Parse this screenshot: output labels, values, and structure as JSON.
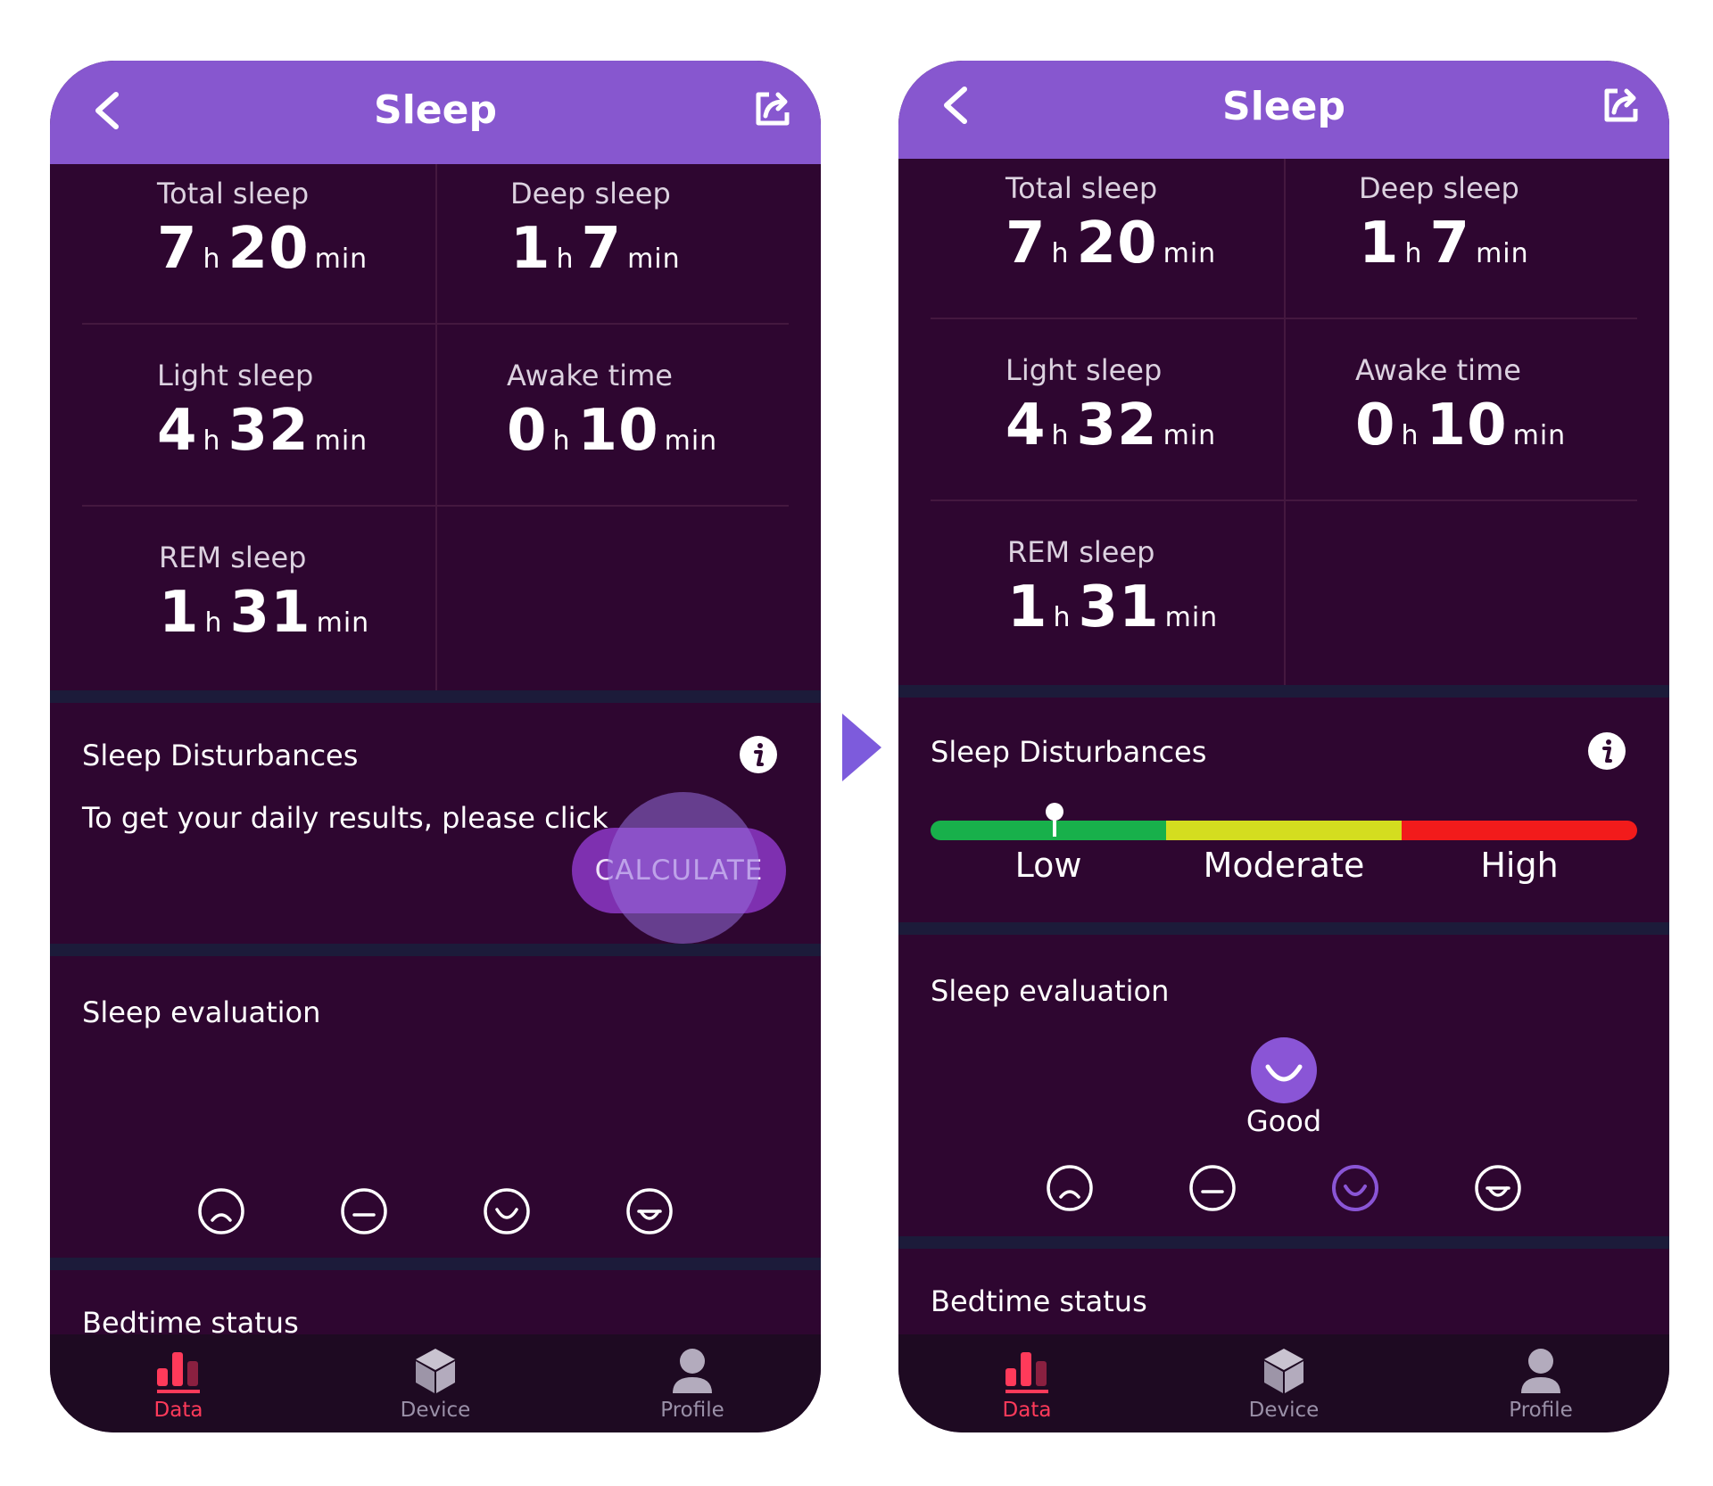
{
  "colors": {
    "header": "#8757cf",
    "background": "#2e0630",
    "accent_active": "#ff3a5a",
    "low": "#18b04b",
    "moderate": "#d4dd1f",
    "high": "#f21b1b",
    "good_face": "#8a55d6"
  },
  "before": {
    "header": {
      "title": "Sleep",
      "back_icon": "chevron-left-icon",
      "share_icon": "share-icon"
    },
    "stats": [
      {
        "label": "Total sleep",
        "hours": "7",
        "minutes": "20"
      },
      {
        "label": "Deep sleep",
        "hours": "1",
        "minutes": "7"
      },
      {
        "label": "Light sleep",
        "hours": "4",
        "minutes": "32"
      },
      {
        "label": "Awake time",
        "hours": "0",
        "minutes": "10"
      },
      {
        "label": "REM sleep",
        "hours": "1",
        "minutes": "31"
      }
    ],
    "units": {
      "hour": "h",
      "minute": "min"
    },
    "disturbances": {
      "title": "Sleep Disturbances",
      "message": "To get your daily results, please click",
      "button_label": "CALCULATE"
    },
    "evaluation": {
      "title": "Sleep evaluation",
      "faces": [
        "sad-face-icon",
        "neutral-face-icon",
        "smile-face-icon",
        "grin-face-icon"
      ]
    },
    "bedtime": {
      "title": "Bedtime status"
    },
    "tabs": [
      {
        "label": "Data",
        "icon": "bar-chart-icon",
        "active": true
      },
      {
        "label": "Device",
        "icon": "cube-icon",
        "active": false
      },
      {
        "label": "Profile",
        "icon": "person-icon",
        "active": false
      }
    ]
  },
  "after": {
    "header": {
      "title": "Sleep",
      "back_icon": "chevron-left-icon",
      "share_icon": "share-icon"
    },
    "stats": [
      {
        "label": "Total sleep",
        "hours": "7",
        "minutes": "20"
      },
      {
        "label": "Deep sleep",
        "hours": "1",
        "minutes": "7"
      },
      {
        "label": "Light sleep",
        "hours": "4",
        "minutes": "32"
      },
      {
        "label": "Awake time",
        "hours": "0",
        "minutes": "10"
      },
      {
        "label": "REM sleep",
        "hours": "1",
        "minutes": "31"
      }
    ],
    "units": {
      "hour": "h",
      "minute": "min"
    },
    "disturbances": {
      "title": "Sleep Disturbances",
      "levels": [
        "Low",
        "Moderate",
        "High"
      ],
      "marker_level": "Low"
    },
    "evaluation": {
      "title": "Sleep evaluation",
      "result": "Good",
      "selected_index": 2,
      "faces": [
        "sad-face-icon",
        "neutral-face-icon",
        "smile-face-icon",
        "grin-face-icon"
      ]
    },
    "bedtime": {
      "title": "Bedtime status"
    },
    "tabs": [
      {
        "label": "Data",
        "icon": "bar-chart-icon",
        "active": true
      },
      {
        "label": "Device",
        "icon": "cube-icon",
        "active": false
      },
      {
        "label": "Profile",
        "icon": "person-icon",
        "active": false
      }
    ]
  }
}
